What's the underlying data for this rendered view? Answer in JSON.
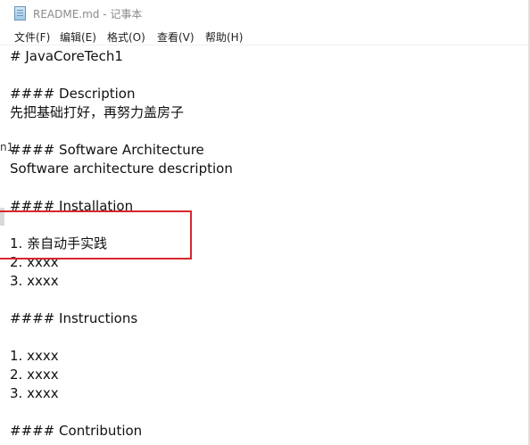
{
  "window": {
    "title": "README.md - 记事本",
    "icon": "notepad-icon"
  },
  "menu": [
    {
      "label": "文件(F)"
    },
    {
      "label": "编辑(E)"
    },
    {
      "label": "格式(O)"
    },
    {
      "label": "查看(V)"
    },
    {
      "label": "帮助(H)"
    }
  ],
  "editor": {
    "lines": [
      "# JavaCoreTech1",
      "",
      "#### Description",
      "先把基础打好，再努力盖房子",
      "",
      "#### Software Architecture",
      "Software architecture description",
      "",
      "#### Installation",
      "",
      "1. 亲自动手实践",
      "2. xxxx",
      "3. xxxx",
      "",
      "#### Instructions",
      "",
      "1. xxxx",
      "2. xxxx",
      "3. xxxx",
      "",
      "#### Contribution"
    ],
    "left_fragment": "n1"
  },
  "annotation": {
    "color": "#d9262c",
    "highlighted_line": "1. 亲自动手实践"
  }
}
